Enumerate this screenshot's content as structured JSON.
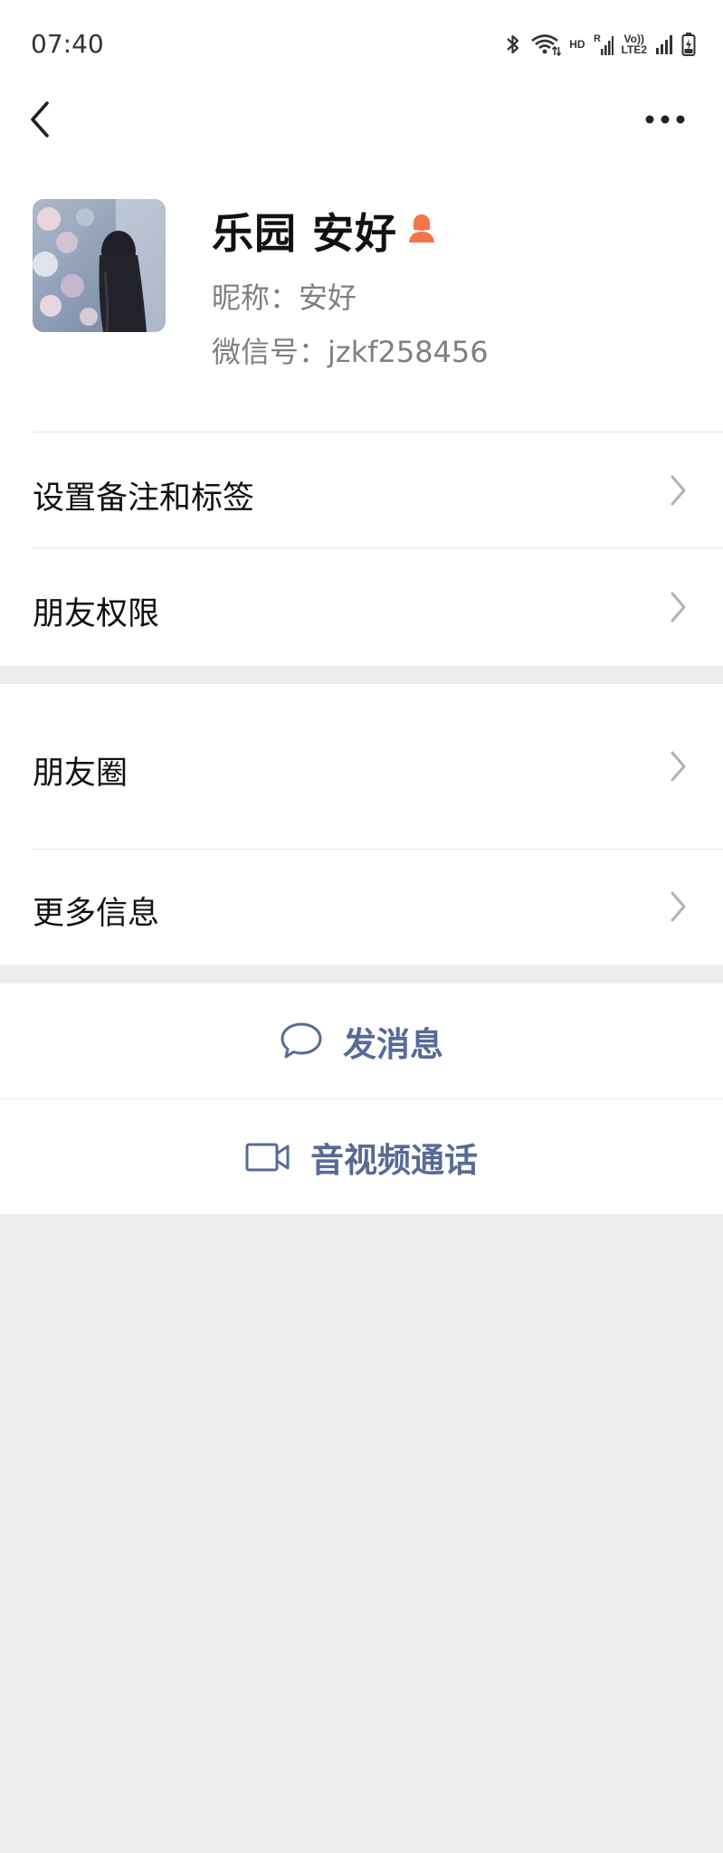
{
  "status_bar": {
    "time": "07:40",
    "indicators": {
      "bluetooth": "bluetooth-icon",
      "wifi": "wifi-icon",
      "hd": "HD",
      "signal_1_label": "R",
      "volte_top": "Vo))",
      "volte_bottom": "LTE2",
      "battery": "battery-charging-icon"
    }
  },
  "nav": {
    "back_icon": "chevron-left-icon",
    "more_icon": "more-dots-icon"
  },
  "profile": {
    "display_name": "乐园 安好",
    "gender_icon": "female-icon",
    "nickname": "昵称：安好",
    "wechat_id": "微信号：jzkf258456"
  },
  "menu": {
    "set_remark_tags": "设置备注和标签",
    "friend_permissions": "朋友权限",
    "moments": "朋友圈",
    "more_info": "更多信息"
  },
  "actions": {
    "send_message": "发消息",
    "av_call": "音视频通话"
  },
  "colors": {
    "link": "#576b95",
    "gender": "#f4754b",
    "page_bg": "#ededed",
    "cell_bg": "#ffffff"
  }
}
